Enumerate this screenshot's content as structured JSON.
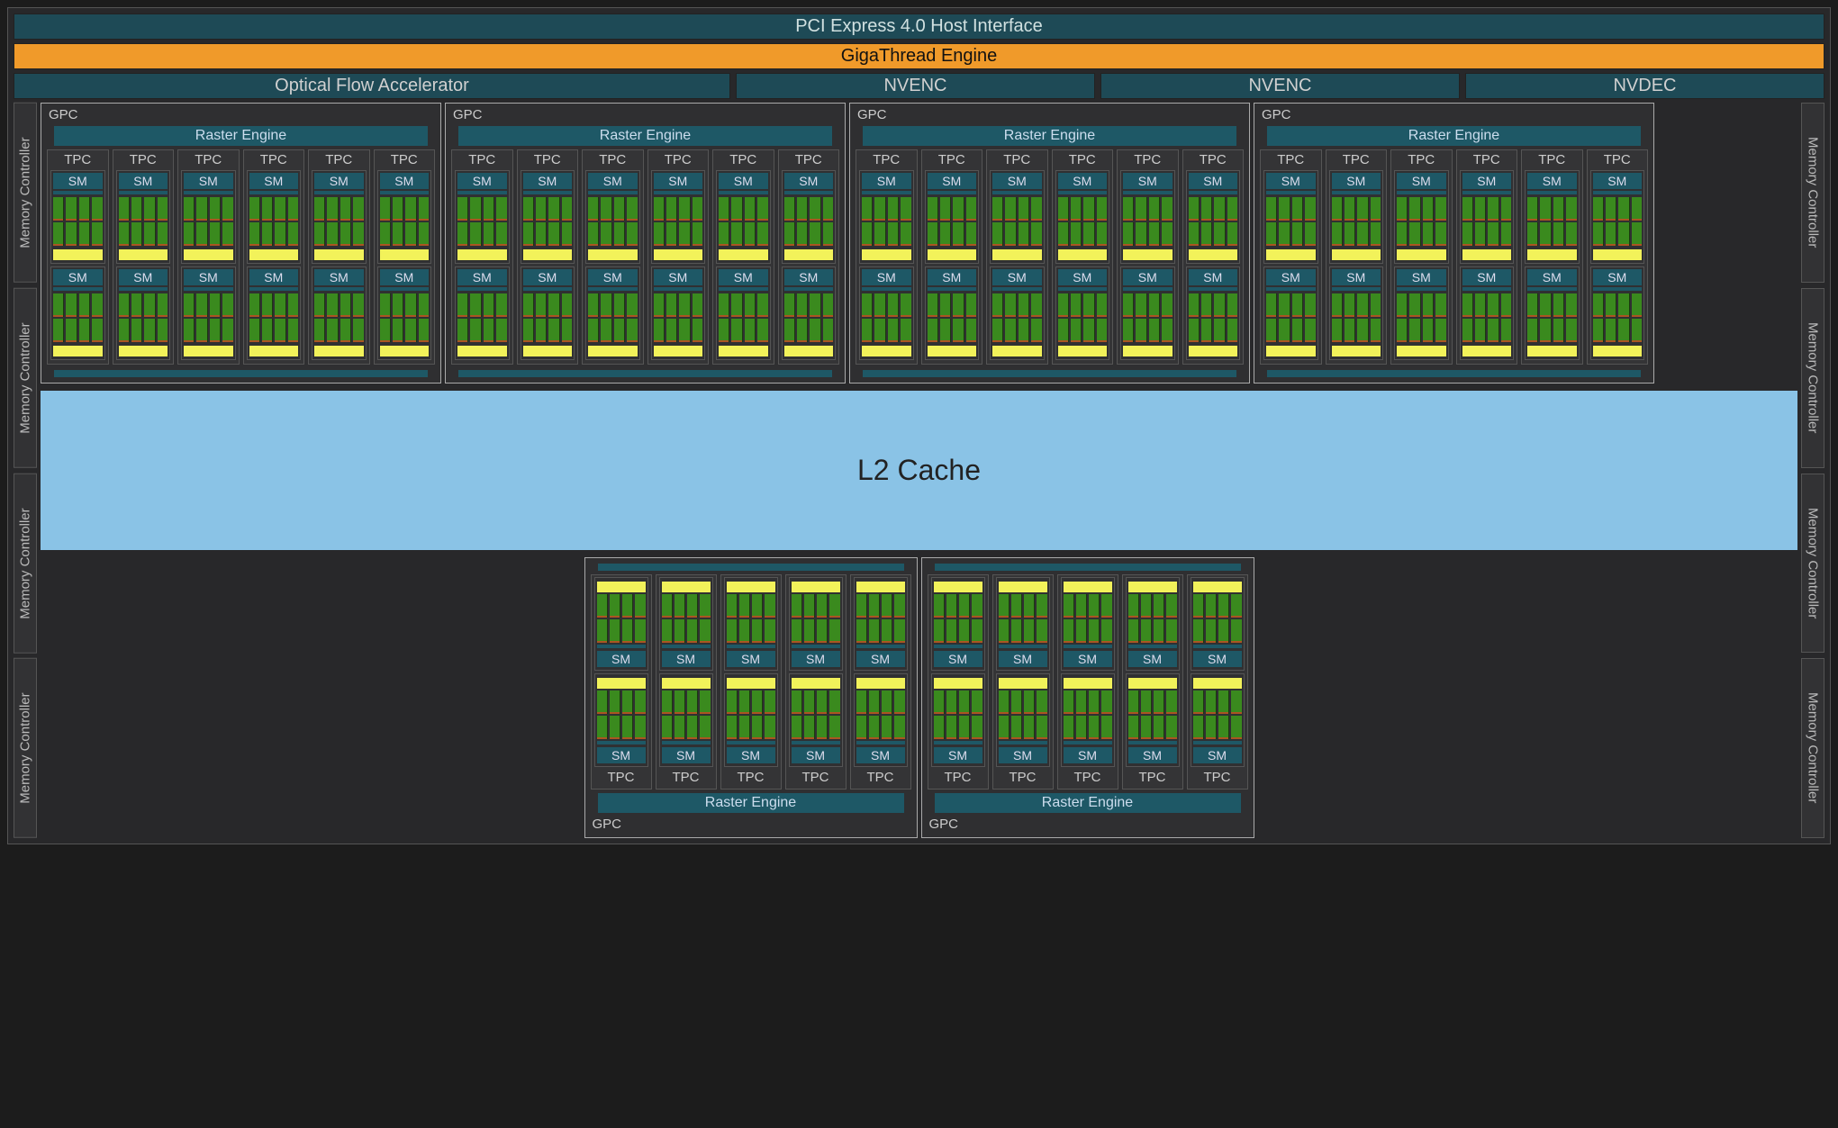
{
  "pci_label": "PCI Express 4.0 Host Interface",
  "gigathread_label": "GigaThread Engine",
  "ofa_label": "Optical Flow Accelerator",
  "nvenc_label": "NVENC",
  "nvdec_label": "NVDEC",
  "memctrl_label": "Memory Controller",
  "gpc_label": "GPC",
  "raster_label": "Raster Engine",
  "tpc_label": "TPC",
  "sm_label": "SM",
  "l2_label": "L2 Cache",
  "top_gpc_count": 4,
  "top_tpcs_per_gpc": 6,
  "bottom_gpc_count": 2,
  "bottom_tpcs_per_gpc": 5,
  "sms_per_tpc": 2,
  "memory_controllers_per_side": 4,
  "nvenc_count": 2,
  "nvdec_count": 1
}
